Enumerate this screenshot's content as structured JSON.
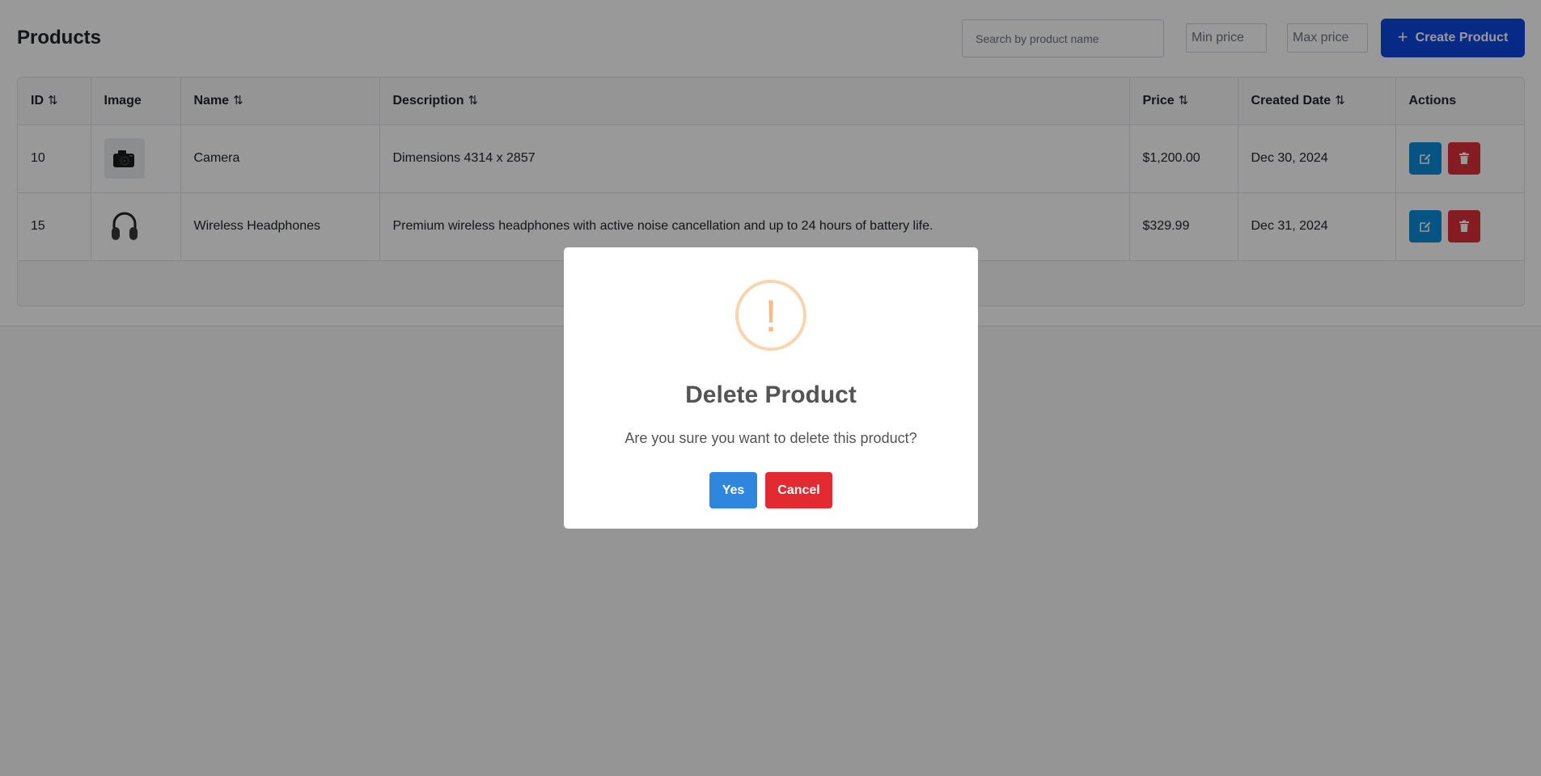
{
  "header": {
    "title": "Products",
    "search_placeholder": "Search by product name",
    "min_price_placeholder": "Min price",
    "max_price_placeholder": "Max price",
    "create_label": "Create Product",
    "create_icon": "plus-icon"
  },
  "table": {
    "columns": [
      {
        "label": "ID",
        "sort_icon": "sort-ascending-icon",
        "sort_glyph": "⇅"
      },
      {
        "label": "Image"
      },
      {
        "label": "Name",
        "sort_icon": "sort-icon",
        "sort_glyph": "⇅"
      },
      {
        "label": "Description",
        "sort_icon": "sort-icon",
        "sort_glyph": "⇅"
      },
      {
        "label": "Price",
        "sort_icon": "sort-icon",
        "sort_glyph": "⇅"
      },
      {
        "label": "Created Date",
        "sort_icon": "sort-icon",
        "sort_glyph": "⇅"
      },
      {
        "label": "Actions"
      }
    ],
    "rows": [
      {
        "id": "10",
        "image": "camera-image",
        "name": "Camera",
        "description": "Dimensions 4314 x 2857",
        "price": "$1,200.00",
        "created": "Dec 30, 2024"
      },
      {
        "id": "15",
        "image": "headphones-image",
        "name": "Wireless Headphones",
        "description": "Premium wireless headphones with active noise cancellation and up to 24 hours of battery life.",
        "price": "$329.99",
        "created": "Dec 31, 2024"
      }
    ],
    "edit_icon": "edit-icon",
    "delete_icon": "trash-icon"
  },
  "modal": {
    "icon": "warning-icon",
    "icon_glyph": "!",
    "title": "Delete Product",
    "text": "Are you sure you want to delete this product?",
    "confirm_label": "Yes",
    "cancel_label": "Cancel"
  },
  "colors": {
    "primary": "#0d47e0",
    "edit": "#0d8ddb",
    "danger": "#dc2f3a",
    "confirm": "#2e86de",
    "warning": "#f8bb86"
  }
}
